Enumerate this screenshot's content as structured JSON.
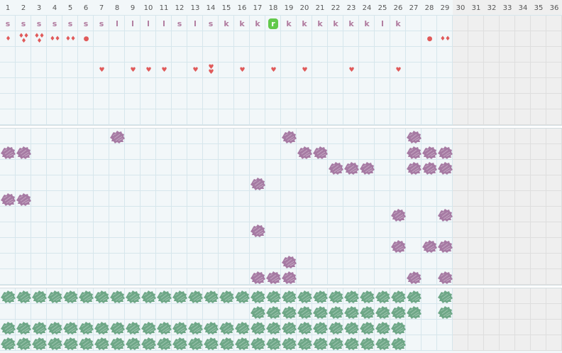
{
  "columns": [
    "1",
    "2",
    "3",
    "4",
    "5",
    "6",
    "7",
    "8",
    "9",
    "10",
    "11",
    "12",
    "13",
    "14",
    "15",
    "16",
    "17",
    "18",
    "19",
    "20",
    "21",
    "22",
    "23",
    "24",
    "25",
    "26",
    "27",
    "28",
    "29",
    "30",
    "31",
    "32",
    "33",
    "34",
    "35",
    "36"
  ],
  "past_from_column": "30",
  "colors": {
    "grid_bg": "#f2f7f9",
    "grid_line": "#d6e6ec",
    "past_bg": "#efefef",
    "letter": "#b07a9e",
    "highlight_badge": "#62c94b",
    "symbol": "#e05a5a",
    "purple_blob": "#a67aa3",
    "green_blob": "#6ea787"
  },
  "letters_row": [
    {
      "col": "1",
      "text": "s"
    },
    {
      "col": "2",
      "text": "s"
    },
    {
      "col": "3",
      "text": "s"
    },
    {
      "col": "4",
      "text": "s"
    },
    {
      "col": "5",
      "text": "s"
    },
    {
      "col": "6",
      "text": "s"
    },
    {
      "col": "7",
      "text": "s"
    },
    {
      "col": "8",
      "text": "l"
    },
    {
      "col": "9",
      "text": "l"
    },
    {
      "col": "10",
      "text": "l"
    },
    {
      "col": "11",
      "text": "l"
    },
    {
      "col": "12",
      "text": "s"
    },
    {
      "col": "13",
      "text": "l"
    },
    {
      "col": "14",
      "text": "s"
    },
    {
      "col": "15",
      "text": "k"
    },
    {
      "col": "16",
      "text": "k"
    },
    {
      "col": "17",
      "text": "k"
    },
    {
      "col": "18",
      "text": "r",
      "highlight": true
    },
    {
      "col": "19",
      "text": "k"
    },
    {
      "col": "20",
      "text": "k"
    },
    {
      "col": "21",
      "text": "k"
    },
    {
      "col": "22",
      "text": "k"
    },
    {
      "col": "23",
      "text": "k"
    },
    {
      "col": "24",
      "text": "k"
    },
    {
      "col": "25",
      "text": "l"
    },
    {
      "col": "26",
      "text": "k"
    }
  ],
  "drops_row": [
    {
      "col": "1",
      "icon": "drop-icon",
      "glyph": "♦"
    },
    {
      "col": "2",
      "icon": "drops-triple-icon",
      "glyph": "♦♦\n♦"
    },
    {
      "col": "3",
      "icon": "drops-triple-icon",
      "glyph": "♦♦\n♦"
    },
    {
      "col": "4",
      "icon": "drops-double-icon",
      "glyph": "♦♦"
    },
    {
      "col": "5",
      "icon": "drops-double-icon",
      "glyph": "♦♦"
    },
    {
      "col": "6",
      "icon": "dot-icon",
      "glyph": "●"
    },
    {
      "col": "28",
      "icon": "dot-icon",
      "glyph": "●"
    },
    {
      "col": "29",
      "icon": "drops-double-icon",
      "glyph": "♦♦"
    }
  ],
  "hearts_row": [
    {
      "col": "7",
      "icon": "heart-icon",
      "glyph": "♥"
    },
    {
      "col": "9",
      "icon": "heart-icon",
      "glyph": "♥"
    },
    {
      "col": "10",
      "icon": "heart-icon",
      "glyph": "♥"
    },
    {
      "col": "11",
      "icon": "heart-icon",
      "glyph": "♥"
    },
    {
      "col": "13",
      "icon": "heart-icon",
      "glyph": "♥"
    },
    {
      "col": "14",
      "icon": "hearts-double-icon",
      "glyph": "♥\n♥"
    },
    {
      "col": "16",
      "icon": "heart-icon",
      "glyph": "♥"
    },
    {
      "col": "18",
      "icon": "heart-icon",
      "glyph": "♥"
    },
    {
      "col": "20",
      "icon": "heart-icon",
      "glyph": "♥"
    },
    {
      "col": "23",
      "icon": "heart-icon",
      "glyph": "♥"
    },
    {
      "col": "26",
      "icon": "heart-icon",
      "glyph": "♥"
    }
  ],
  "purple_marks": [
    {
      "row": 1,
      "cols": [
        8,
        19,
        27
      ]
    },
    {
      "row": 2,
      "cols": [
        1,
        2,
        20,
        21,
        27,
        28,
        29
      ]
    },
    {
      "row": 3,
      "cols": [
        22,
        23,
        24,
        27,
        28,
        29
      ]
    },
    {
      "row": 4,
      "cols": [
        17
      ]
    },
    {
      "row": 5,
      "cols": [
        1,
        2
      ]
    },
    {
      "row": 6,
      "cols": [
        26,
        29
      ]
    },
    {
      "row": 7,
      "cols": [
        17
      ]
    },
    {
      "row": 8,
      "cols": [
        26,
        28,
        29
      ]
    },
    {
      "row": 9,
      "cols": [
        19
      ]
    },
    {
      "row": 10,
      "cols": [
        17,
        18,
        19,
        27,
        29
      ]
    }
  ],
  "green_marks": [
    {
      "row": 1,
      "cols": [
        1,
        2,
        3,
        4,
        5,
        6,
        7,
        8,
        9,
        10,
        11,
        12,
        13,
        14,
        15,
        16,
        17,
        18,
        19,
        20,
        21,
        22,
        23,
        24,
        25,
        26,
        27,
        29
      ]
    },
    {
      "row": 2,
      "cols": [
        17,
        18,
        19,
        20,
        21,
        22,
        23,
        24,
        25,
        26,
        27,
        29
      ]
    },
    {
      "row": 3,
      "cols": [
        1,
        2,
        3,
        4,
        5,
        6,
        7,
        8,
        9,
        10,
        11,
        12,
        13,
        14,
        15,
        16,
        17,
        18,
        19,
        20,
        21,
        22,
        23,
        24,
        25,
        26
      ]
    },
    {
      "row": 4,
      "cols": [
        1,
        2,
        3,
        4,
        5,
        6,
        7,
        8,
        9,
        10,
        11,
        12,
        13,
        14,
        15,
        16,
        17,
        18,
        19,
        20,
        21,
        22,
        23,
        24,
        25,
        26
      ]
    }
  ]
}
